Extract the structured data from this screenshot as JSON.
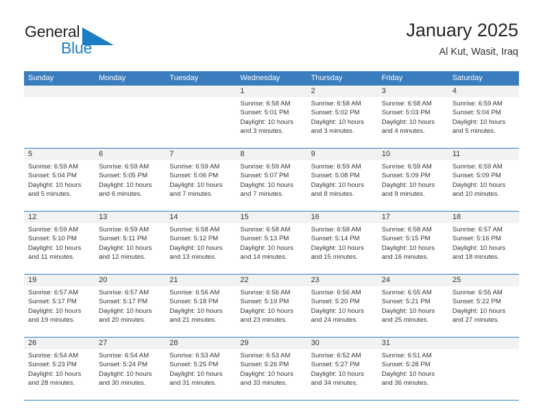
{
  "logo": {
    "word1": "General",
    "word2": "Blue",
    "triangle_color": "#1b7dc4",
    "word1_color": "#231f20",
    "word2_color": "#1b7dc4"
  },
  "header": {
    "title": "January 2025",
    "subtitle": "Al Kut, Wasit, Iraq"
  },
  "colors": {
    "header_row_bg": "#3a7dbf",
    "header_row_text": "#ffffff",
    "daynum_band_bg": "#f2f2f2",
    "cell_bg": "#ffffff",
    "row_divider": "#3a7dbf",
    "body_text": "#333333"
  },
  "weekdays": [
    "Sunday",
    "Monday",
    "Tuesday",
    "Wednesday",
    "Thursday",
    "Friday",
    "Saturday"
  ],
  "weeks": [
    [
      {
        "day": "",
        "lines": []
      },
      {
        "day": "",
        "lines": []
      },
      {
        "day": "",
        "lines": []
      },
      {
        "day": "1",
        "lines": [
          "Sunrise: 6:58 AM",
          "Sunset: 5:01 PM",
          "Daylight: 10 hours and 3 minutes."
        ]
      },
      {
        "day": "2",
        "lines": [
          "Sunrise: 6:58 AM",
          "Sunset: 5:02 PM",
          "Daylight: 10 hours and 3 minutes."
        ]
      },
      {
        "day": "3",
        "lines": [
          "Sunrise: 6:58 AM",
          "Sunset: 5:03 PM",
          "Daylight: 10 hours and 4 minutes."
        ]
      },
      {
        "day": "4",
        "lines": [
          "Sunrise: 6:59 AM",
          "Sunset: 5:04 PM",
          "Daylight: 10 hours and 5 minutes."
        ]
      }
    ],
    [
      {
        "day": "5",
        "lines": [
          "Sunrise: 6:59 AM",
          "Sunset: 5:04 PM",
          "Daylight: 10 hours and 5 minutes."
        ]
      },
      {
        "day": "6",
        "lines": [
          "Sunrise: 6:59 AM",
          "Sunset: 5:05 PM",
          "Daylight: 10 hours and 6 minutes."
        ]
      },
      {
        "day": "7",
        "lines": [
          "Sunrise: 6:59 AM",
          "Sunset: 5:06 PM",
          "Daylight: 10 hours and 7 minutes."
        ]
      },
      {
        "day": "8",
        "lines": [
          "Sunrise: 6:59 AM",
          "Sunset: 5:07 PM",
          "Daylight: 10 hours and 7 minutes."
        ]
      },
      {
        "day": "9",
        "lines": [
          "Sunrise: 6:59 AM",
          "Sunset: 5:08 PM",
          "Daylight: 10 hours and 8 minutes."
        ]
      },
      {
        "day": "10",
        "lines": [
          "Sunrise: 6:59 AM",
          "Sunset: 5:09 PM",
          "Daylight: 10 hours and 9 minutes."
        ]
      },
      {
        "day": "11",
        "lines": [
          "Sunrise: 6:59 AM",
          "Sunset: 5:09 PM",
          "Daylight: 10 hours and 10 minutes."
        ]
      }
    ],
    [
      {
        "day": "12",
        "lines": [
          "Sunrise: 6:59 AM",
          "Sunset: 5:10 PM",
          "Daylight: 10 hours and 11 minutes."
        ]
      },
      {
        "day": "13",
        "lines": [
          "Sunrise: 6:59 AM",
          "Sunset: 5:11 PM",
          "Daylight: 10 hours and 12 minutes."
        ]
      },
      {
        "day": "14",
        "lines": [
          "Sunrise: 6:58 AM",
          "Sunset: 5:12 PM",
          "Daylight: 10 hours and 13 minutes."
        ]
      },
      {
        "day": "15",
        "lines": [
          "Sunrise: 6:58 AM",
          "Sunset: 5:13 PM",
          "Daylight: 10 hours and 14 minutes."
        ]
      },
      {
        "day": "16",
        "lines": [
          "Sunrise: 6:58 AM",
          "Sunset: 5:14 PM",
          "Daylight: 10 hours and 15 minutes."
        ]
      },
      {
        "day": "17",
        "lines": [
          "Sunrise: 6:58 AM",
          "Sunset: 5:15 PM",
          "Daylight: 10 hours and 16 minutes."
        ]
      },
      {
        "day": "18",
        "lines": [
          "Sunrise: 6:57 AM",
          "Sunset: 5:16 PM",
          "Daylight: 10 hours and 18 minutes."
        ]
      }
    ],
    [
      {
        "day": "19",
        "lines": [
          "Sunrise: 6:57 AM",
          "Sunset: 5:17 PM",
          "Daylight: 10 hours and 19 minutes."
        ]
      },
      {
        "day": "20",
        "lines": [
          "Sunrise: 6:57 AM",
          "Sunset: 5:17 PM",
          "Daylight: 10 hours and 20 minutes."
        ]
      },
      {
        "day": "21",
        "lines": [
          "Sunrise: 6:56 AM",
          "Sunset: 5:18 PM",
          "Daylight: 10 hours and 21 minutes."
        ]
      },
      {
        "day": "22",
        "lines": [
          "Sunrise: 6:56 AM",
          "Sunset: 5:19 PM",
          "Daylight: 10 hours and 23 minutes."
        ]
      },
      {
        "day": "23",
        "lines": [
          "Sunrise: 6:56 AM",
          "Sunset: 5:20 PM",
          "Daylight: 10 hours and 24 minutes."
        ]
      },
      {
        "day": "24",
        "lines": [
          "Sunrise: 6:55 AM",
          "Sunset: 5:21 PM",
          "Daylight: 10 hours and 25 minutes."
        ]
      },
      {
        "day": "25",
        "lines": [
          "Sunrise: 6:55 AM",
          "Sunset: 5:22 PM",
          "Daylight: 10 hours and 27 minutes."
        ]
      }
    ],
    [
      {
        "day": "26",
        "lines": [
          "Sunrise: 6:54 AM",
          "Sunset: 5:23 PM",
          "Daylight: 10 hours and 28 minutes."
        ]
      },
      {
        "day": "27",
        "lines": [
          "Sunrise: 6:54 AM",
          "Sunset: 5:24 PM",
          "Daylight: 10 hours and 30 minutes."
        ]
      },
      {
        "day": "28",
        "lines": [
          "Sunrise: 6:53 AM",
          "Sunset: 5:25 PM",
          "Daylight: 10 hours and 31 minutes."
        ]
      },
      {
        "day": "29",
        "lines": [
          "Sunrise: 6:53 AM",
          "Sunset: 5:26 PM",
          "Daylight: 10 hours and 33 minutes."
        ]
      },
      {
        "day": "30",
        "lines": [
          "Sunrise: 6:52 AM",
          "Sunset: 5:27 PM",
          "Daylight: 10 hours and 34 minutes."
        ]
      },
      {
        "day": "31",
        "lines": [
          "Sunrise: 6:51 AM",
          "Sunset: 5:28 PM",
          "Daylight: 10 hours and 36 minutes."
        ]
      },
      {
        "day": "",
        "lines": []
      }
    ]
  ]
}
